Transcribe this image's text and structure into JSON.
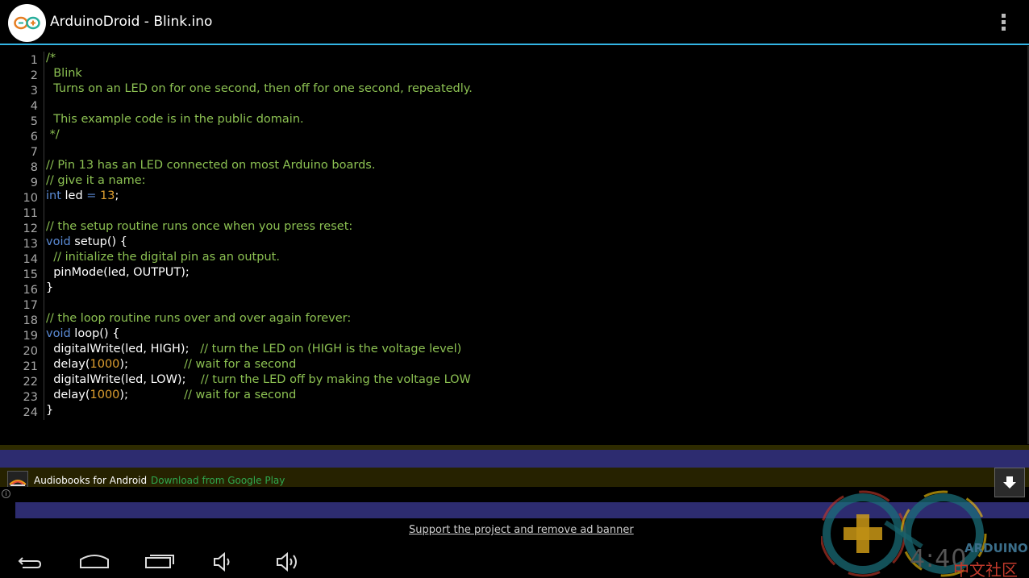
{
  "actionbar": {
    "title": "ArduinoDroid - Blink.ino",
    "menu_icon": "overflow-menu-icon",
    "app_icon": "arduino-logo-icon"
  },
  "editor": {
    "lines": [
      {
        "n": "1",
        "tokens": [
          {
            "t": "/*",
            "c": "comment"
          }
        ]
      },
      {
        "n": "2",
        "tokens": [
          {
            "t": "  Blink",
            "c": "comment"
          }
        ]
      },
      {
        "n": "3",
        "tokens": [
          {
            "t": "  Turns on an LED on for one second, then off for one second, repeatedly.",
            "c": "comment"
          }
        ]
      },
      {
        "n": "4",
        "tokens": []
      },
      {
        "n": "5",
        "tokens": [
          {
            "t": "  This example code is in the public domain.",
            "c": "comment"
          }
        ]
      },
      {
        "n": "6",
        "tokens": [
          {
            "t": " */",
            "c": "comment"
          }
        ]
      },
      {
        "n": "7",
        "tokens": []
      },
      {
        "n": "8",
        "tokens": [
          {
            "t": "// Pin 13 has an LED connected on most Arduino boards.",
            "c": "comment"
          }
        ]
      },
      {
        "n": "9",
        "tokens": [
          {
            "t": "// give it a name:",
            "c": "comment"
          }
        ]
      },
      {
        "n": "10",
        "tokens": [
          {
            "t": "int",
            "c": "keyword"
          },
          {
            "t": " led ",
            "c": "plain"
          },
          {
            "t": "=",
            "c": "keyword"
          },
          {
            "t": " ",
            "c": "plain"
          },
          {
            "t": "13",
            "c": "number"
          },
          {
            "t": ";",
            "c": "plain"
          }
        ]
      },
      {
        "n": "11",
        "tokens": []
      },
      {
        "n": "12",
        "tokens": [
          {
            "t": "// the setup routine runs once when you press reset:",
            "c": "comment"
          }
        ]
      },
      {
        "n": "13",
        "tokens": [
          {
            "t": "void",
            "c": "keyword"
          },
          {
            "t": " setup() {",
            "c": "plain"
          }
        ]
      },
      {
        "n": "14",
        "tokens": [
          {
            "t": "  // initialize the digital pin as an output.",
            "c": "comment"
          }
        ]
      },
      {
        "n": "15",
        "tokens": [
          {
            "t": "  pinMode(led, OUTPUT);",
            "c": "plain"
          }
        ]
      },
      {
        "n": "16",
        "tokens": [
          {
            "t": "}",
            "c": "plain"
          }
        ]
      },
      {
        "n": "17",
        "tokens": []
      },
      {
        "n": "18",
        "tokens": [
          {
            "t": "// the loop routine runs over and over again forever:",
            "c": "comment"
          }
        ]
      },
      {
        "n": "19",
        "tokens": [
          {
            "t": "void",
            "c": "keyword"
          },
          {
            "t": " loop() {",
            "c": "plain"
          }
        ]
      },
      {
        "n": "20",
        "tokens": [
          {
            "t": "  digitalWrite(led, HIGH);   ",
            "c": "plain"
          },
          {
            "t": "// turn the LED on (HIGH is the voltage level)",
            "c": "comment"
          }
        ]
      },
      {
        "n": "21",
        "tokens": [
          {
            "t": "  delay(",
            "c": "plain"
          },
          {
            "t": "1000",
            "c": "number"
          },
          {
            "t": ");               ",
            "c": "plain"
          },
          {
            "t": "// wait for a second",
            "c": "comment"
          }
        ]
      },
      {
        "n": "22",
        "tokens": [
          {
            "t": "  digitalWrite(led, LOW);    ",
            "c": "plain"
          },
          {
            "t": "// turn the LED off by making the voltage LOW",
            "c": "comment"
          }
        ]
      },
      {
        "n": "23",
        "tokens": [
          {
            "t": "  delay(",
            "c": "plain"
          },
          {
            "t": "1000",
            "c": "number"
          },
          {
            "t": ");               ",
            "c": "plain"
          },
          {
            "t": "// wait for a second",
            "c": "comment"
          }
        ]
      },
      {
        "n": "24",
        "tokens": [
          {
            "t": "}",
            "c": "plain"
          }
        ]
      }
    ]
  },
  "colors": {
    "comment": "#8cc152",
    "keyword": "#5b8bd6",
    "number": "#e0a030",
    "plain": "#ffffff",
    "accent": "#33b5e5"
  },
  "ad": {
    "title": "Audiobooks for Android",
    "subtitle": "Download from Google Play",
    "info": "i",
    "download_icon": "download-arrow-icon"
  },
  "support_link": "Support the project and remove ad banner",
  "navbar": {
    "back": "back-icon",
    "home": "home-icon",
    "recents": "recents-icon",
    "vol_down": "volume-down-icon",
    "vol_up": "volume-up-icon"
  },
  "watermark": {
    "clock": "4:40",
    "brand": "ARDUINO",
    "cn": "中文社区"
  }
}
